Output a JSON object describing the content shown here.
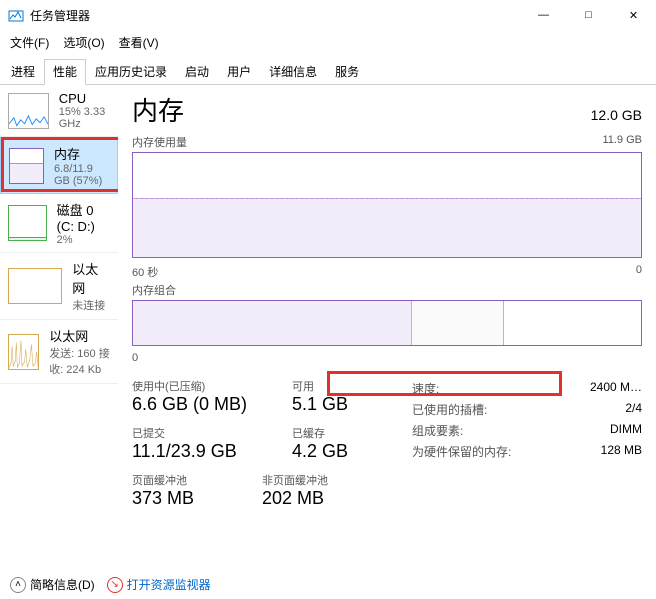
{
  "window": {
    "title": "任务管理器",
    "controls": {
      "min": "—",
      "max": "□",
      "close": "✕"
    }
  },
  "menu": {
    "file": "文件(F)",
    "options": "选项(O)",
    "view": "查看(V)"
  },
  "tabs": {
    "processes": "进程",
    "performance": "性能",
    "history": "应用历史记录",
    "startup": "启动",
    "users": "用户",
    "details": "详细信息",
    "services": "服务"
  },
  "sidebar": {
    "items": [
      {
        "title": "CPU",
        "sub": "15% 3.33 GHz"
      },
      {
        "title": "内存",
        "sub": "6.8/11.9 GB (57%)"
      },
      {
        "title": "磁盘 0 (C: D:)",
        "sub": "2%"
      },
      {
        "title": "以太网",
        "sub": "未连接"
      },
      {
        "title": "以太网",
        "sub": "发送: 160 接收: 224 Kb"
      }
    ]
  },
  "main": {
    "title": "内存",
    "total": "12.0 GB",
    "usage_label": "内存使用量",
    "usage_max": "11.9 GB",
    "axis_60s": "60 秒",
    "axis_0": "0",
    "comp_label": "内存组合",
    "comp_0": "0"
  },
  "stats": {
    "in_use_label": "使用中(已压缩)",
    "in_use_value": "6.6 GB (0 MB)",
    "avail_label": "可用",
    "avail_value": "5.1 GB",
    "committed_label": "已提交",
    "committed_value": "11.1/23.9 GB",
    "cached_label": "已缓存",
    "cached_value": "4.2 GB",
    "paged_label": "页面缓冲池",
    "paged_value": "373 MB",
    "nonpaged_label": "非页面缓冲池",
    "nonpaged_value": "202 MB"
  },
  "specs": {
    "speed_label": "速度:",
    "speed_value": "2400 M…",
    "slots_label": "已使用的插槽:",
    "slots_value": "2/4",
    "form_label": "组成要素:",
    "form_value": "DIMM",
    "reserved_label": "为硬件保留的内存:",
    "reserved_value": "128 MB"
  },
  "footer": {
    "brief": "简略信息(D)",
    "resmon": "打开资源监视器"
  },
  "chart_data": {
    "type": "area",
    "title": "内存使用量",
    "ylim": [
      0,
      11.9
    ],
    "ylabel": "GB",
    "xlabel": "秒",
    "xlim": [
      60,
      0
    ],
    "series": [
      {
        "name": "内存",
        "values_approx": 6.8,
        "color": "#8b5fbf"
      }
    ]
  }
}
